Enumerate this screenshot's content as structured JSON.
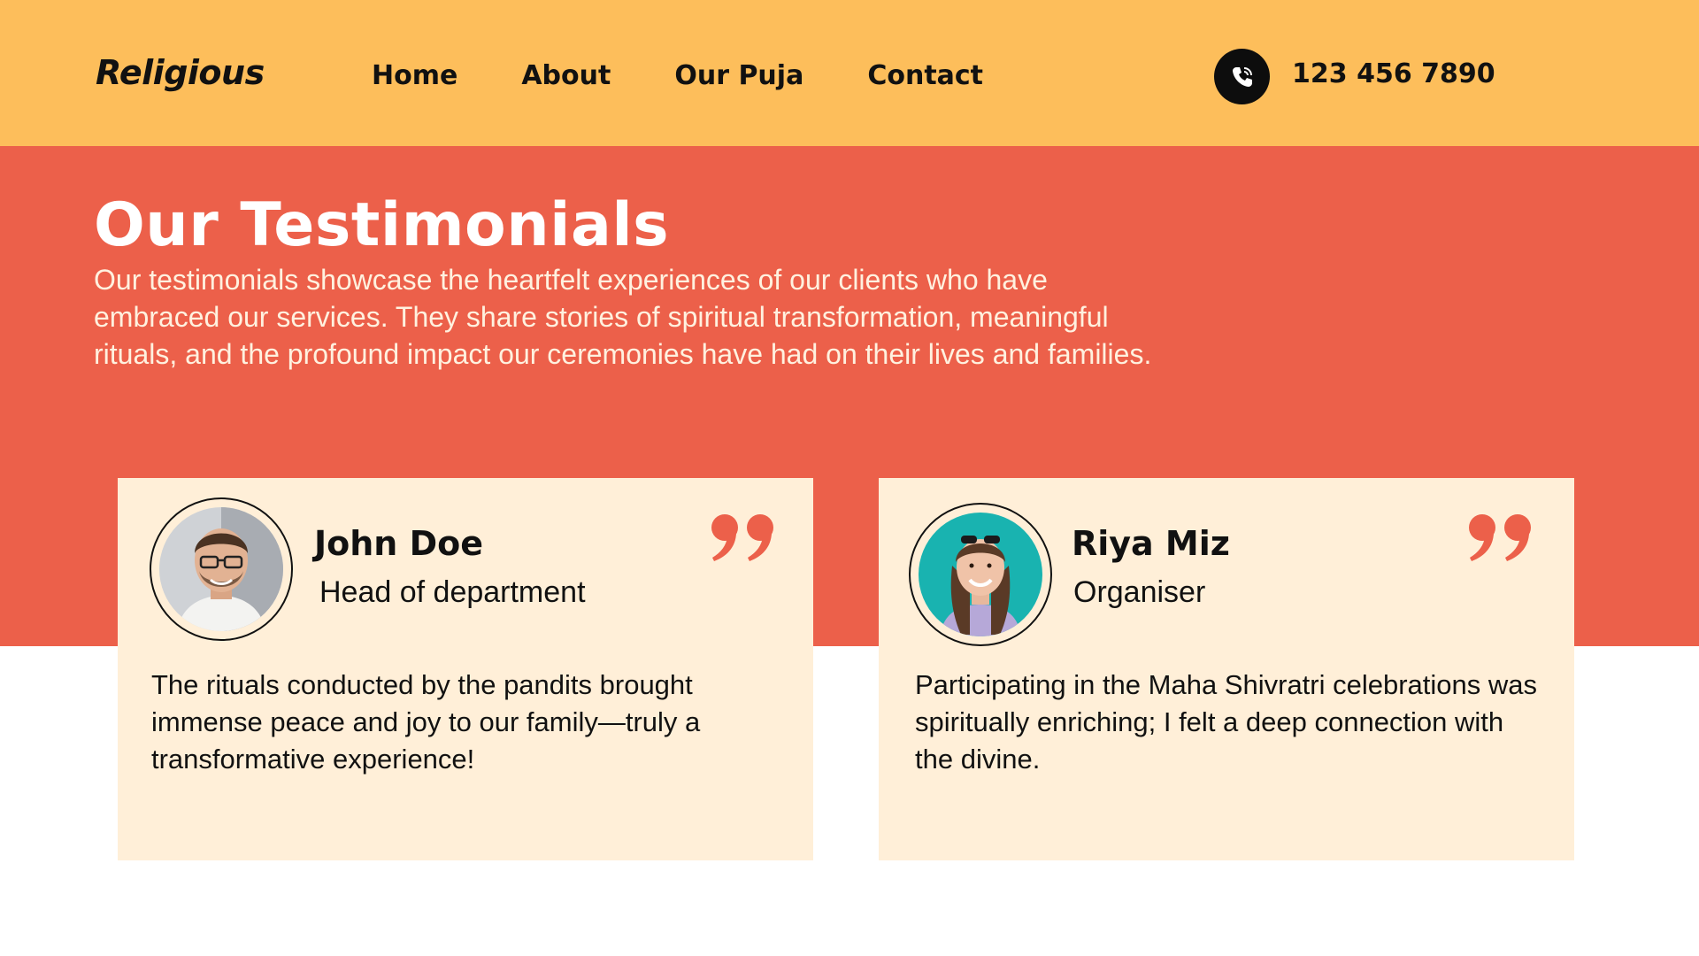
{
  "header": {
    "logo": "Religious",
    "nav": [
      "Home",
      "About",
      "Our Puja",
      "Contact"
    ],
    "phone": "123 456 7890",
    "phone_icon": "phone-icon"
  },
  "hero": {
    "title": "Our Testimonials",
    "description": "Our testimonials showcase the heartfelt experiences of our clients who have embraced our services. They share stories of spiritual transformation, meaningful rituals, and the profound impact our ceremonies have had on their lives and families."
  },
  "testimonials": [
    {
      "name": "John Doe",
      "role": "Head of department",
      "text": "The rituals conducted by the pandits brought immense peace and joy to our family—truly a transformative experience!",
      "icon": "quote-icon"
    },
    {
      "name": "Riya Miz",
      "role": "Organiser",
      "text": "Participating in the Maha Shivratri celebrations was spiritually enriching; I felt a deep connection with the divine.",
      "icon": "quote-icon"
    }
  ],
  "colors": {
    "header_bg": "#FDBE5B",
    "hero_bg": "#EC604A",
    "card_bg": "#FFEFD8",
    "accent": "#EC604A"
  }
}
